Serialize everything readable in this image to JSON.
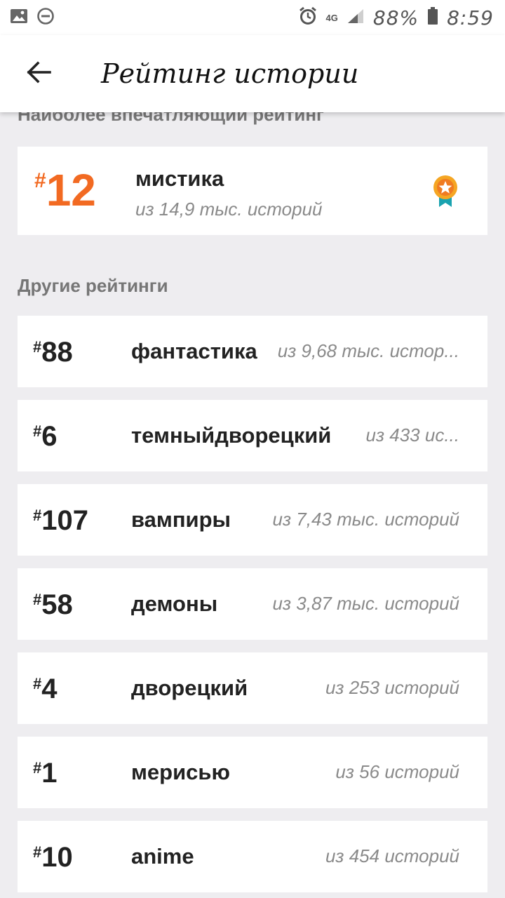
{
  "status_bar": {
    "network": "4G",
    "battery": "88%",
    "time": "8:59"
  },
  "app_bar": {
    "title": "Рейтинг истории"
  },
  "top_section": {
    "title": "Наиболее впечатляющий рейтинг",
    "hash": "#",
    "rank": "12",
    "tag": "мистика",
    "count": "из 14,9 тыс. историй",
    "rank_color": "#f26a22"
  },
  "other_section": {
    "title": "Другие рейтинги",
    "hash": "#",
    "items": [
      {
        "rank": "88",
        "tag": "фантастика",
        "count": "из 9,68 тыс. истор..."
      },
      {
        "rank": "6",
        "tag": "темныйдворецкий",
        "count": "из 433 ис..."
      },
      {
        "rank": "107",
        "tag": "вампиры",
        "count": "из 7,43 тыс. историй"
      },
      {
        "rank": "58",
        "tag": "демоны",
        "count": "из 3,87 тыс. историй"
      },
      {
        "rank": "4",
        "tag": "дворецкий",
        "count": "из 253 историй"
      },
      {
        "rank": "1",
        "tag": "мерисью",
        "count": "из 56 историй"
      },
      {
        "rank": "10",
        "tag": "anime",
        "count": "из 454 историй"
      }
    ]
  },
  "icons": {
    "back": "arrow-back-icon",
    "medal": "medal-icon"
  }
}
